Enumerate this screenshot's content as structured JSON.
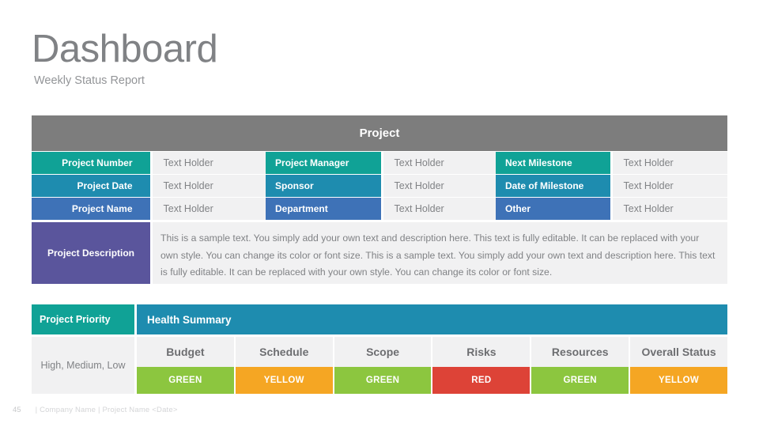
{
  "header": {
    "title": "Dashboard",
    "subtitle": "Weekly Status Report"
  },
  "project_table": {
    "section_title": "Project",
    "section_title_bg": "#7D7D7D",
    "rows": [
      {
        "label1": "Project Number",
        "value1": "Text Holder",
        "label2": "Project Manager",
        "value2": "Text Holder",
        "label3": "Next Milestone",
        "value3": "Text Holder",
        "color": "#10A296"
      },
      {
        "label1": "Project Date",
        "value1": "Text Holder",
        "label2": "Sponsor",
        "value2": "Text Holder",
        "label3": "Date of Milestone",
        "value3": "Text Holder",
        "color": "#1E8CAF"
      },
      {
        "label1": "Project Name",
        "value1": "Text Holder",
        "label2": "Department",
        "value2": "Text Holder",
        "label3": "Other",
        "value3": "Text Holder",
        "color": "#3E72B7"
      }
    ],
    "description": {
      "label": "Project Description",
      "label_bg": "#5A559C",
      "text": "This is a sample text. You simply add your own text and description here. This text is fully editable. It can be replaced with your own style. You can change its color or font size. This is a sample text. You simply add your own text and description here. This text is fully editable. It can be replaced with your own style. You can change its color or font size."
    }
  },
  "health_summary": {
    "priority_label": "Project Priority",
    "priority_label_bg": "#10A296",
    "summary_label": "Health Summary",
    "summary_label_bg": "#1E8CAF",
    "priority_value": "High, Medium, Low",
    "metrics": [
      {
        "name": "Budget",
        "status": "GREEN",
        "color": "#8CC63F"
      },
      {
        "name": "Schedule",
        "status": "YELLOW",
        "color": "#F5A623"
      },
      {
        "name": "Scope",
        "status": "GREEN",
        "color": "#8CC63F"
      },
      {
        "name": "Risks",
        "status": "RED",
        "color": "#DD4337"
      },
      {
        "name": "Resources",
        "status": "GREEN",
        "color": "#8CC63F"
      },
      {
        "name": "Overall Status",
        "status": "YELLOW",
        "color": "#F5A623"
      }
    ]
  },
  "footer": {
    "page_number": "45",
    "text": "| Company Name | Project Name <Date>"
  }
}
